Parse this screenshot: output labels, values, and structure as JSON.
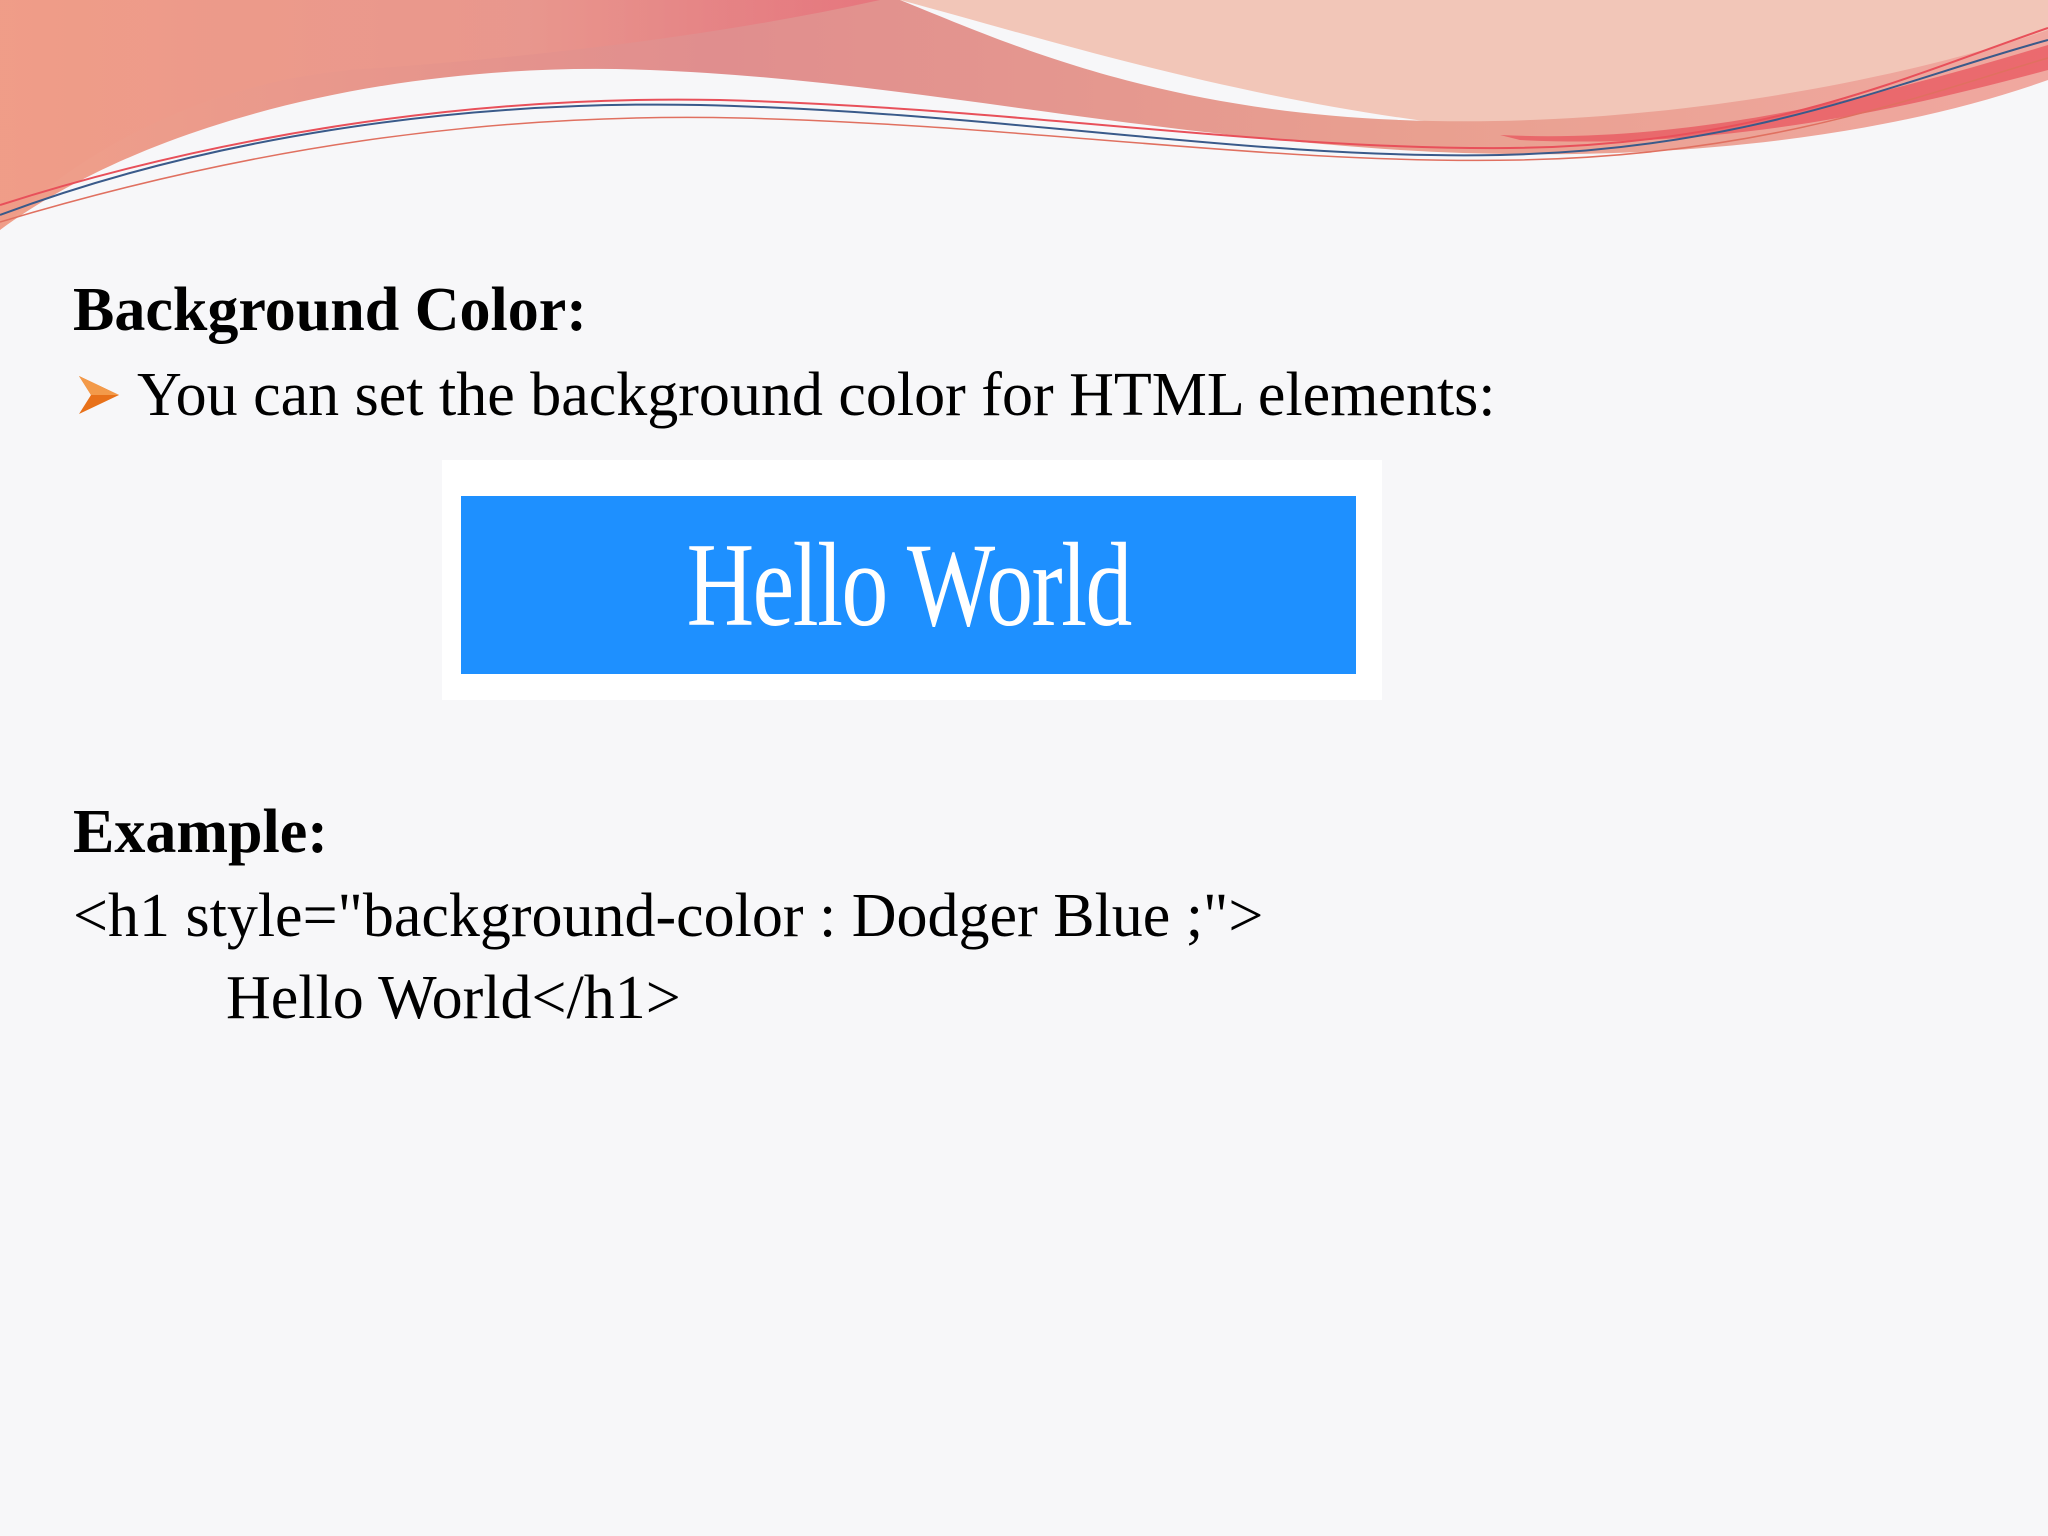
{
  "slide": {
    "heading": "Background Color:",
    "bullet": {
      "icon": "arrow-bullet-icon",
      "icon_color": "#e8711a",
      "text": "You can set the background color for HTML elements:"
    },
    "demo": {
      "text": "Hello World",
      "background_color": "#1e90ff",
      "text_color": "#ffffff"
    },
    "example_label": "Example:",
    "code_lines": [
      "<h1 style=\"background-color : Dodger Blue ;\">",
      "Hello World</h1>"
    ]
  },
  "theme": {
    "wave_colors": [
      "#e08a8a",
      "#f0a58f",
      "#e8505a",
      "#3a5a8a"
    ],
    "background": "#f7f7f9"
  }
}
